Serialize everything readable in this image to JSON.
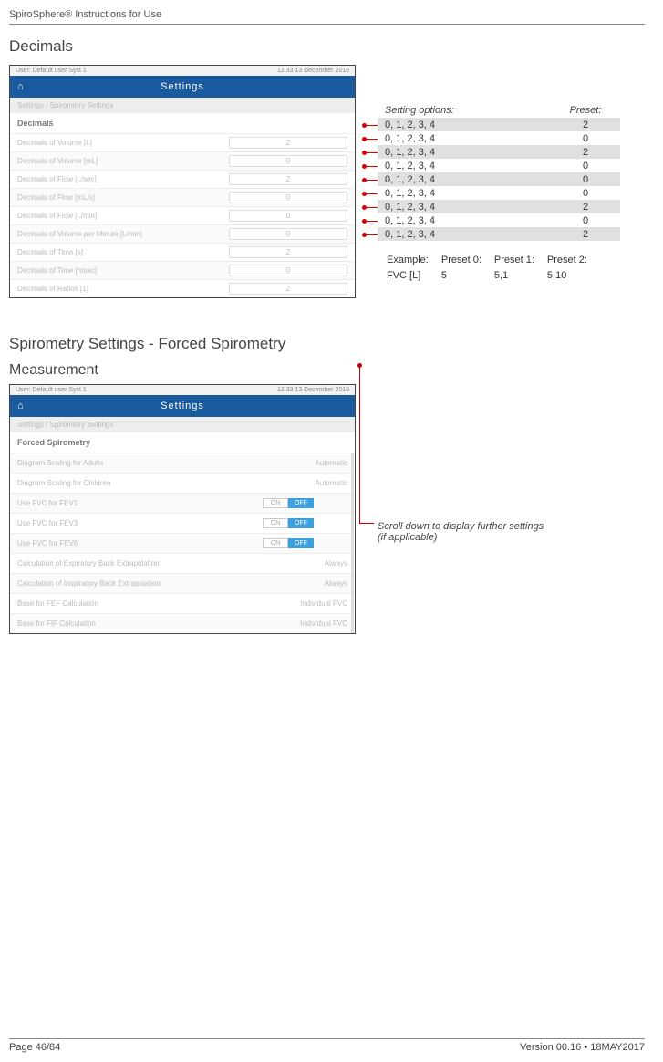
{
  "doc": {
    "header": "SpiroSphere® Instructions for Use",
    "page": "Page 46/84",
    "version": "Version 00.16 • 18MAY2017"
  },
  "section1": {
    "title": "Decimals",
    "status_left": "User: Default user Syst 1",
    "status_right": "12:33 13 December 2016",
    "titlebar": "Settings",
    "breadcrumb": "Settings / Spirometry Settings",
    "section_head": "Decimals",
    "rows": [
      {
        "label": "Decimals of Volume [L]",
        "val": "2"
      },
      {
        "label": "Decimals of Volume [mL]",
        "val": "0"
      },
      {
        "label": "Decimals of Flow [L/sec]",
        "val": "2"
      },
      {
        "label": "Decimals of Flow [mL/s]",
        "val": "0"
      },
      {
        "label": "Decimals of Flow [L/min]",
        "val": "0"
      },
      {
        "label": "Decimals of Volume per Minute [L/min]",
        "val": "0"
      },
      {
        "label": "Decimals of Time [s]",
        "val": "2"
      },
      {
        "label": "Decimals of Time [msec]",
        "val": "0"
      },
      {
        "label": "Decimals of Ratios [1]",
        "val": "2"
      }
    ],
    "table_head_left": "Setting options:",
    "table_head_right": "Preset:",
    "options_rows": [
      {
        "opts": "0, 1, 2, 3, 4",
        "preset": "2"
      },
      {
        "opts": "0, 1, 2, 3, 4",
        "preset": "0"
      },
      {
        "opts": "0, 1, 2, 3, 4",
        "preset": "2"
      },
      {
        "opts": "0, 1, 2, 3, 4",
        "preset": "0"
      },
      {
        "opts": "0, 1, 2, 3, 4",
        "preset": "0"
      },
      {
        "opts": "0, 1, 2, 3, 4",
        "preset": "0"
      },
      {
        "opts": "0, 1, 2, 3, 4",
        "preset": "2"
      },
      {
        "opts": "0, 1, 2, 3, 4",
        "preset": "0"
      },
      {
        "opts": "0, 1, 2, 3, 4",
        "preset": "2"
      }
    ],
    "example": {
      "h": "Example:",
      "p0": "Preset 0:",
      "p1": "Preset 1:",
      "p2": "Preset 2:",
      "r0": "FVC [L]",
      "v0": "5",
      "v1": "5,1",
      "v2": "5,10"
    }
  },
  "section2": {
    "title": "Spirometry Settings - Forced Spirometry",
    "sub": "Measurement",
    "status_left": "User: Default user Syst 1",
    "status_right": "12:33 13 December 2016",
    "titlebar": "Settings",
    "breadcrumb": "Settings / Spirometry Settings",
    "section_head": "Forced Spirometry",
    "on": "ON",
    "off": "OFF",
    "rows": [
      {
        "label": "Diagram Scaling for Adults",
        "type": "drop",
        "val": "Automatic"
      },
      {
        "label": "Diagram Scaling for Children",
        "type": "drop",
        "val": "Automatic"
      },
      {
        "label": "Use FVC for FEV1",
        "type": "toggle",
        "active": "off"
      },
      {
        "label": "Use FVC for FEV3",
        "type": "toggle",
        "active": "off"
      },
      {
        "label": "Use FVC for FEV6",
        "type": "toggle",
        "active": "off"
      },
      {
        "label": "Calculation of Expiratory Back Extrapolation",
        "type": "drop",
        "val": "Always"
      },
      {
        "label": "Calculation of Inspiratory Back Extrapolation",
        "type": "drop",
        "val": "Always"
      },
      {
        "label": "Base for FEF Calculation",
        "type": "drop",
        "val": "Individual FVC"
      },
      {
        "label": "Base for FIF Calculation",
        "type": "drop",
        "val": "Individual FVC"
      }
    ],
    "scroll_note_l1": "Scroll down to display further settings",
    "scroll_note_l2": "(if applicable)"
  }
}
